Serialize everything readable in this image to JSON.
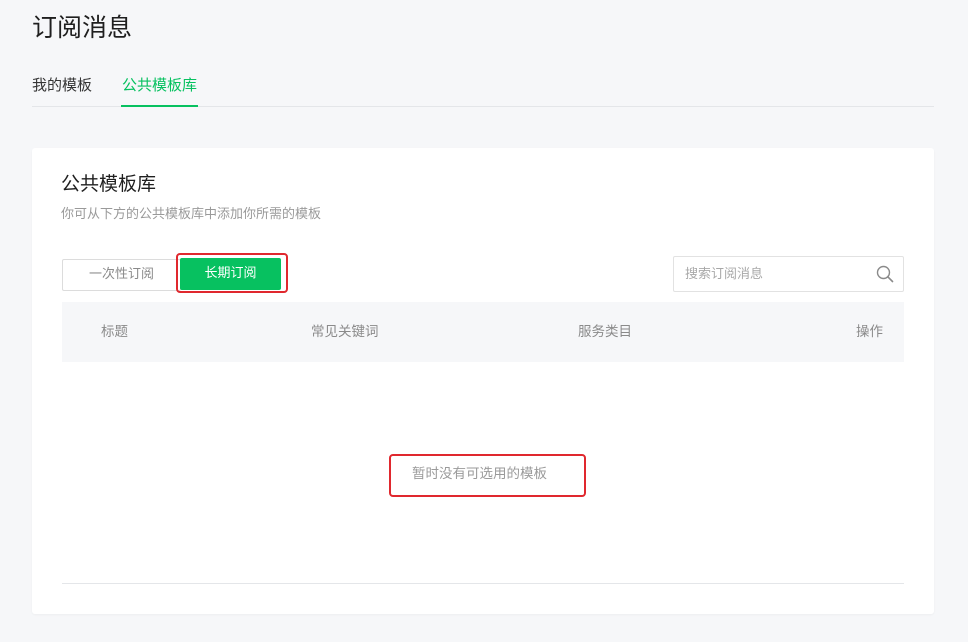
{
  "page": {
    "title": "订阅消息"
  },
  "tabs": [
    {
      "label": "我的模板",
      "active": false
    },
    {
      "label": "公共模板库",
      "active": true
    }
  ],
  "card": {
    "title": "公共模板库",
    "description": "你可从下方的公共模板库中添加你所需的模板"
  },
  "filter": {
    "once_label": "一次性订阅",
    "long_label": "长期订阅",
    "selected": "长期订阅"
  },
  "search": {
    "placeholder": "搜索订阅消息",
    "value": "",
    "icon": "search-icon"
  },
  "table": {
    "columns": [
      "标题",
      "常见关键词",
      "服务类目",
      "操作"
    ],
    "rows": [],
    "empty_text": "暂时没有可选用的模板"
  },
  "colors": {
    "accent": "#07c160",
    "highlight": "#e0282e"
  }
}
